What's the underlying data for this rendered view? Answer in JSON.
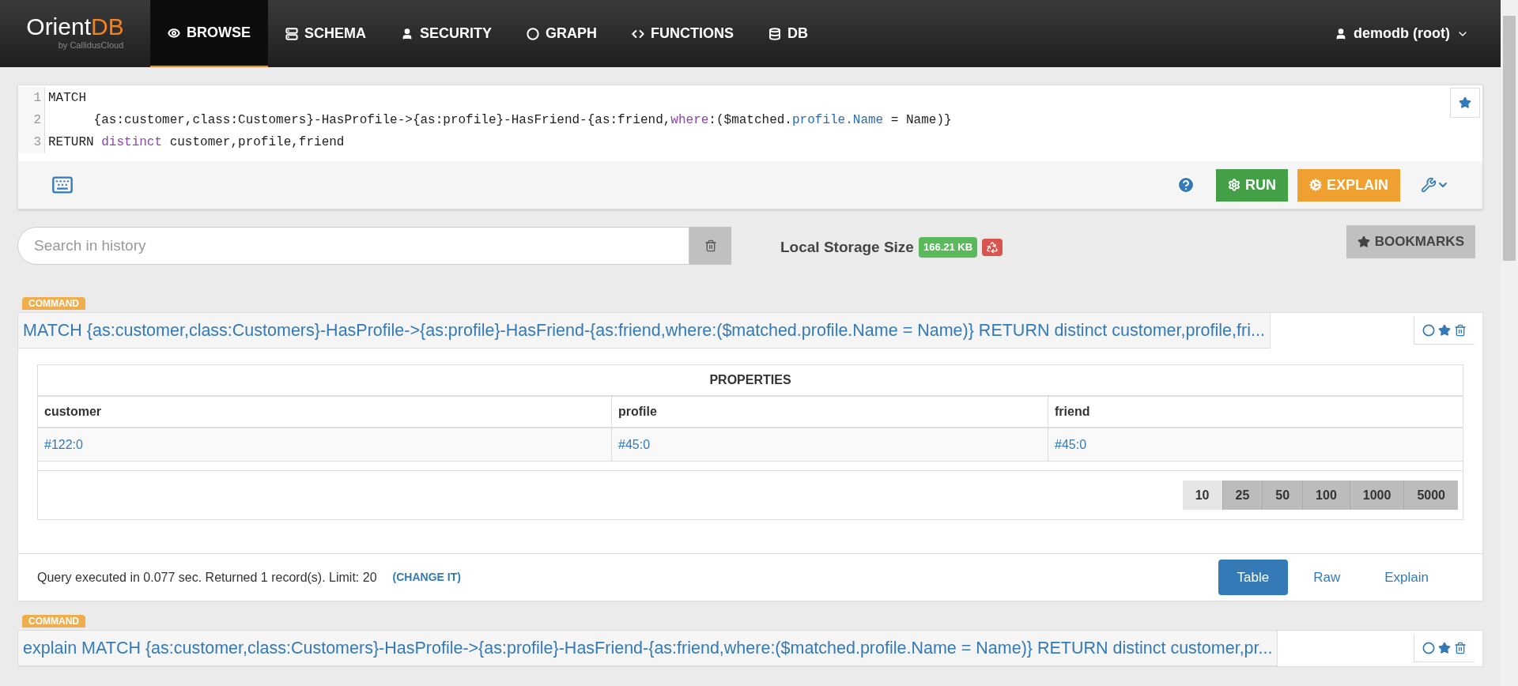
{
  "navbar": {
    "logo": {
      "name": "Orient",
      "name_accent": "DB",
      "tagline": "by CallidusCloud"
    },
    "items": [
      {
        "label": "BROWSE",
        "selected": true
      },
      {
        "label": "SCHEMA",
        "selected": false
      },
      {
        "label": "SECURITY",
        "selected": false
      },
      {
        "label": "GRAPH",
        "selected": false
      },
      {
        "label": "FUNCTIONS",
        "selected": false
      },
      {
        "label": "DB",
        "selected": false
      }
    ],
    "user_menu": "demodb (root)"
  },
  "editor": {
    "lines": [
      {
        "number": "1",
        "tokens": [
          {
            "text": "MATCH",
            "kind": "plain"
          }
        ]
      },
      {
        "number": "2",
        "tokens": [
          {
            "text": "      {as:customer,class:Customers}-HasProfile->{as:profile}-HasFriend-{as:friend,",
            "kind": "plain"
          },
          {
            "text": "where",
            "kind": "keyword"
          },
          {
            "text": ":($matched.",
            "kind": "plain"
          },
          {
            "text": "profile.Name",
            "kind": "property"
          },
          {
            "text": " = Name)}",
            "kind": "plain"
          }
        ]
      },
      {
        "number": "3",
        "tokens": [
          {
            "text": "RETURN ",
            "kind": "plain"
          },
          {
            "text": "distinct",
            "kind": "keyword"
          },
          {
            "text": " customer,profile,friend",
            "kind": "plain"
          }
        ]
      }
    ],
    "run_button": "RUN",
    "explain_button": "EXPLAIN"
  },
  "history": {
    "search_placeholder": "Search in history",
    "storage_label": "Local Storage Size",
    "storage_size": "166.21 KB",
    "bookmarks_button": "BOOKMARKS"
  },
  "commands": [
    {
      "badge": "COMMAND",
      "query": "MATCH {as:customer,class:Customers}-HasProfile->{as:profile}-HasFriend-{as:friend,where:($matched.profile.Name = Name)} RETURN distinct customer,profile,fri...",
      "result": {
        "group_header": "PROPERTIES",
        "columns": [
          "customer",
          "profile",
          "friend"
        ],
        "rows": [
          [
            "#122:0",
            "#45:0",
            "#45:0"
          ]
        ],
        "page_sizes": [
          {
            "label": "10",
            "selected": true
          },
          {
            "label": "25",
            "selected": false
          },
          {
            "label": "50",
            "selected": false
          },
          {
            "label": "100",
            "selected": false
          },
          {
            "label": "1000",
            "selected": false
          },
          {
            "label": "5000",
            "selected": false
          }
        ],
        "status": "Query executed in 0.077 sec. Returned 1 record(s). Limit: 20",
        "change_link": "(CHANGE IT)",
        "views": [
          {
            "label": "Table",
            "selected": true
          },
          {
            "label": "Raw",
            "selected": false
          },
          {
            "label": "Explain",
            "selected": false
          }
        ]
      }
    },
    {
      "badge": "COMMAND",
      "query": "explain MATCH {as:customer,class:Customers}-HasProfile->{as:profile}-HasFriend-{as:friend,where:($matched.profile.Name = Name)} RETURN distinct customer,pr..."
    }
  ]
}
